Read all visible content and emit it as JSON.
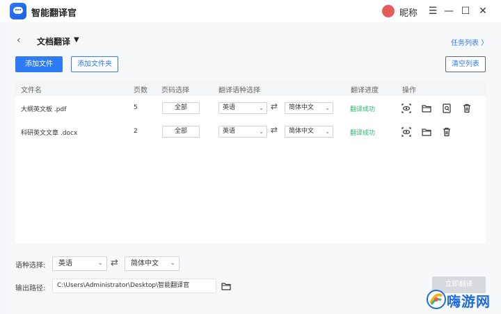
{
  "titlebar": {
    "app_title": "智能翻译官",
    "nickname": "昵称"
  },
  "header": {
    "page_title": "文档翻译",
    "task_list": "任务列表 〉"
  },
  "toolbar": {
    "add_file": "添加文件",
    "add_folder": "添加文件夹",
    "clear_list": "清空列表"
  },
  "table": {
    "columns": [
      "文件名",
      "页数",
      "页码选择",
      "翻译语种选择",
      "翻译进度",
      "操作"
    ],
    "rows": [
      {
        "filename": "大纲英文板 .pdf",
        "pages": "5",
        "page_select": "全部",
        "source_lang": "英语",
        "target_lang": "简体中文",
        "status": "翻译成功"
      },
      {
        "filename": "科研英文文章 .docx",
        "pages": "2",
        "page_select": "全部",
        "source_lang": "英语",
        "target_lang": "简体中文",
        "status": "翻译成功"
      }
    ]
  },
  "bottom": {
    "lang_label": "语种选择:",
    "source_lang": "英语",
    "target_lang": "简体中文",
    "output_label": "输出路径:",
    "output_path": "C:\\Users\\Administrator\\Desktop\\智能翻译官",
    "translate_button": "立即翻译"
  },
  "watermark": {
    "text": "嗨游网"
  },
  "colors": {
    "accent": "#2f7bf6",
    "success": "#2bb673",
    "avatar": "#e55c5c"
  }
}
